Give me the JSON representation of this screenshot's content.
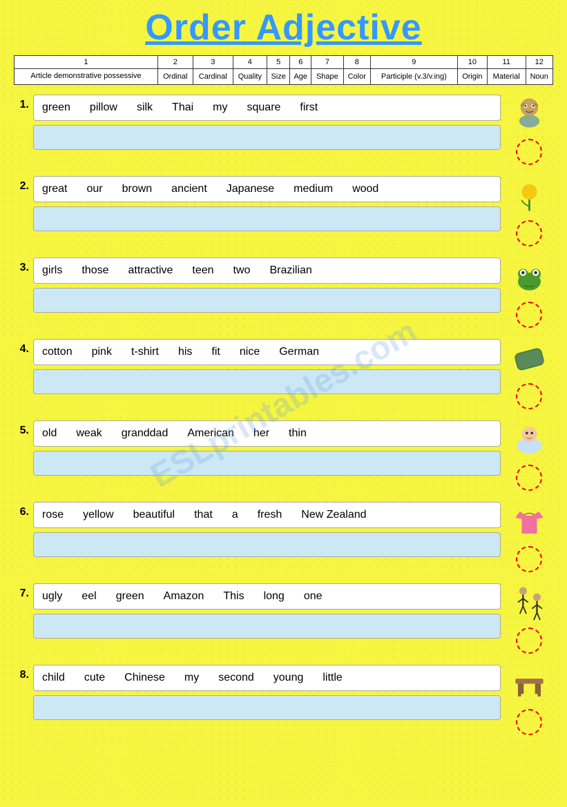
{
  "title": "Order Adjective",
  "watermark": "ESLprintables.com",
  "header": {
    "numbers": [
      "1",
      "2",
      "3",
      "4",
      "5",
      "6",
      "7",
      "8",
      "9",
      "10",
      "11",
      "12"
    ],
    "labels": [
      "Article demonstrative possessive",
      "Ordinal",
      "Cardinal",
      "Quality",
      "Size",
      "Age",
      "Shape",
      "Color",
      "Participle (v.3/v.ing)",
      "Origin",
      "Material",
      "Noun"
    ]
  },
  "exercises": [
    {
      "number": "1.",
      "words": [
        "green",
        "pillow",
        "silk",
        "Thai",
        "my",
        "square",
        "first"
      ],
      "icon": "goblin"
    },
    {
      "number": "2.",
      "words": [
        "great",
        "our",
        "brown",
        "ancient",
        "Japanese",
        "medium",
        "wood"
      ],
      "icon": "rose"
    },
    {
      "number": "3.",
      "words": [
        "girls",
        "those",
        "attractive",
        "teen",
        "two",
        "Brazilian"
      ],
      "icon": "frog"
    },
    {
      "number": "4.",
      "words": [
        "cotton",
        "pink",
        "t-shirt",
        "his",
        "fit",
        "nice",
        "German"
      ],
      "icon": "pillow"
    },
    {
      "number": "5.",
      "words": [
        "old",
        "weak",
        "granddad",
        "American",
        "her",
        "thin"
      ],
      "icon": "baby"
    },
    {
      "number": "6.",
      "words": [
        "rose",
        "yellow",
        "beautiful",
        "that",
        "a",
        "fresh",
        "New Zealand"
      ],
      "icon": "tshirt"
    },
    {
      "number": "7.",
      "words": [
        "ugly",
        "eel",
        "green",
        "Amazon",
        "This",
        "long",
        "one"
      ],
      "icon": "dancers"
    },
    {
      "number": "8.",
      "words": [
        "child",
        "cute",
        "Chinese",
        "my",
        "second",
        "young",
        "little"
      ],
      "icon": "table"
    }
  ]
}
